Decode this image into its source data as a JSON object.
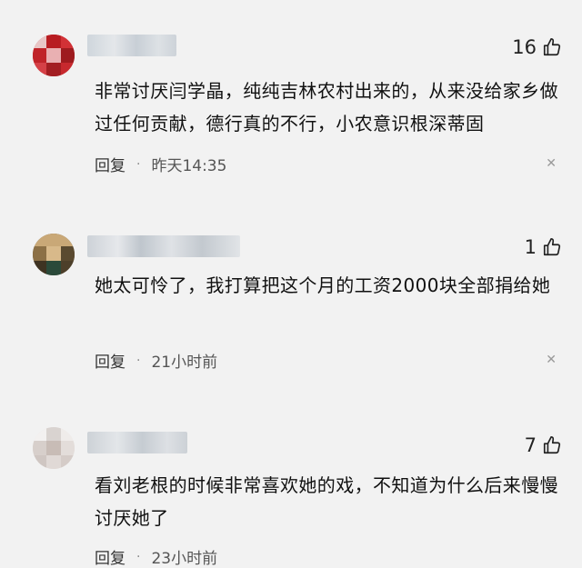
{
  "comments": [
    {
      "likes": "16",
      "text": "非常讨厌闫学晶，纯纯吉林农村出来的，从来没给家乡做过任何贡献，德行真的不行，小农意识根深蒂固",
      "reply_label": "回复",
      "time": "昨天14:35"
    },
    {
      "likes": "1",
      "text": "她太可怜了，我打算把这个月的工资2000块全部捐给她",
      "reply_label": "回复",
      "time": "21小时前"
    },
    {
      "likes": "7",
      "text": "看刘老根的时候非常喜欢她的戏，不知道为什么后来慢慢讨厌她了",
      "reply_label": "回复",
      "time": "23小时前"
    }
  ],
  "icons": {
    "like": "thumbs-up-icon",
    "close": "close-icon"
  },
  "colors": {
    "background": "#f2f2f2",
    "text": "#111111",
    "meta": "#555555"
  }
}
